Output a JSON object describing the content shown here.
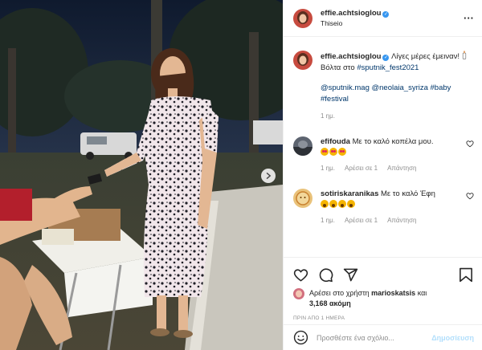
{
  "post": {
    "username": "effie.achtsioglou",
    "location": "Thiseio",
    "caption": {
      "line1": "Λίγες μέρες έμειναν!",
      "line2_prefix": "Βόλτα στο ",
      "line2_tag": "#sputnik_fest2021",
      "mentions": "@sputnik.mag @neolaia_syriza #baby #festival",
      "time": "1 ημ."
    }
  },
  "comments": [
    {
      "username": "efifouda",
      "text": "Με το καλό κοπέλα μου.",
      "emoji": [
        "smiling-face-with-heart-eyes",
        "smiling-face-with-heart-eyes",
        "smiling-face-with-heart-eyes"
      ],
      "time": "1 ημ.",
      "likes": "Αρέσει σε 1",
      "reply": "Απάντηση"
    },
    {
      "username": "sotiriskaranikas",
      "text": "Με το καλό Έφη",
      "emoji": [
        "face-screaming-in-fear",
        "face-screaming-in-fear",
        "face-screaming-in-fear",
        "face-screaming-in-fear"
      ],
      "time": "1 ημ.",
      "likes": "Αρέσει σε 1",
      "reply": "Απάντηση"
    }
  ],
  "likes": {
    "prefix": "Αρέσει στο χρήστη ",
    "user": "marioskatsis",
    "connector": " και",
    "count": "3,168 ακόμη"
  },
  "posted_ago": "ΠΡΙΝ ΑΠΟ 1 ΗΜΕΡΑ",
  "comment_box": {
    "placeholder": "Προσθέστε ένα σχόλιο...",
    "submit": "Δημοσίευση"
  },
  "colors": {
    "link": "#00376b",
    "verified": "#3897f0",
    "submit_disabled": "#b2dffc",
    "muted": "#8e8e8e"
  },
  "icons": [
    "verified-badge-icon",
    "more-options-icon",
    "heart-icon",
    "comment-icon",
    "share-icon",
    "bookmark-icon",
    "emoji-icon",
    "next-arrow-icon"
  ]
}
